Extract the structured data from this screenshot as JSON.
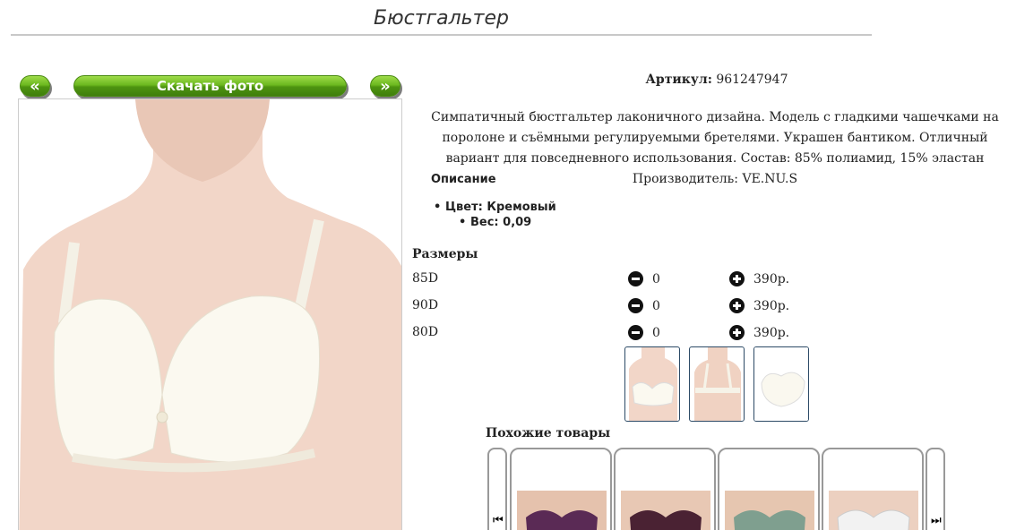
{
  "page": {
    "title": "Бюстгальтер"
  },
  "gallery": {
    "prev_label": "«",
    "download_label": "Скачать фото",
    "next_label": "»"
  },
  "product": {
    "article_label": "Артикул:",
    "article_value": "961247947",
    "description": "Симпатичный бюстгальтер лаконичного дизайна. Модель с гладкими чашечками на поролоне и съёмными регулируемыми бретелями. Украшен бантиком. Отличный вариант для повседневного использования. Состав: 85% полиамид, 15% эластан Производитель: VE.NU.S",
    "section_title": "Описание",
    "attributes": [
      {
        "text": "Цвет: Кремовый"
      },
      {
        "text": "Вес: 0,09"
      }
    ]
  },
  "sizes": {
    "heading": "Размеры",
    "rows": [
      {
        "size": "85D",
        "qty": "0",
        "price": "390р."
      },
      {
        "size": "90D",
        "qty": "0",
        "price": "390р."
      },
      {
        "size": "80D",
        "qty": "0",
        "price": "390р."
      }
    ]
  },
  "similar": {
    "heading": "Похожие товары",
    "colors": [
      "#5a2a55",
      "#4a2233",
      "#7f9f8f",
      "#eeeeee"
    ]
  }
}
